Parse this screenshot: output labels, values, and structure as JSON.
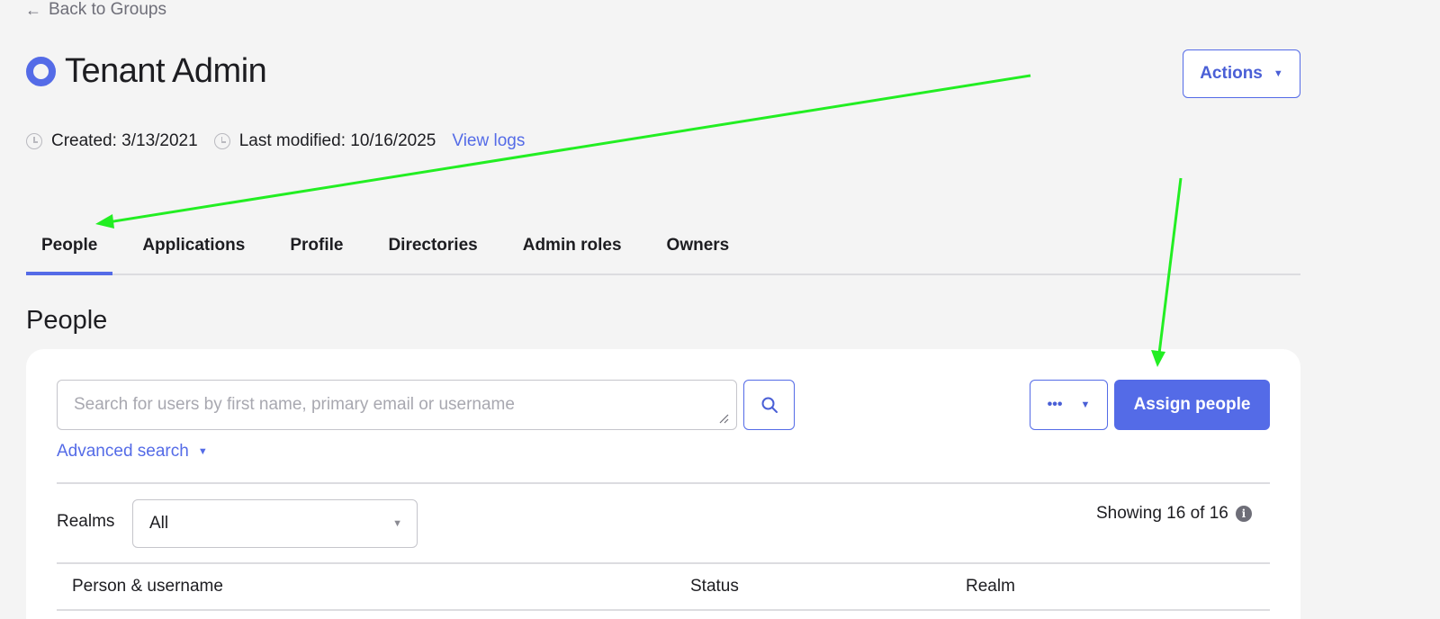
{
  "nav": {
    "back_label": "Back to Groups",
    "back_icon": "arrow-left-icon"
  },
  "header": {
    "title": "Tenant Admin",
    "actions_label": "Actions",
    "created": "Created: 3/13/2021",
    "last_modified": "Last modified: 10/16/2025",
    "view_logs": "View logs"
  },
  "tabs": [
    {
      "label": "People",
      "active": true
    },
    {
      "label": "Applications",
      "active": false
    },
    {
      "label": "Profile",
      "active": false
    },
    {
      "label": "Directories",
      "active": false
    },
    {
      "label": "Admin roles",
      "active": false
    },
    {
      "label": "Owners",
      "active": false
    }
  ],
  "section": {
    "title": "People"
  },
  "toolbar": {
    "search_placeholder": "Search for users by first name, primary email or username",
    "more_label": "•••",
    "assign_label": "Assign people",
    "advanced_search": "Advanced search"
  },
  "filters": {
    "realms_label": "Realms",
    "realms_value": "All",
    "showing": "Showing 16 of 16"
  },
  "table": {
    "columns": [
      "Person & username",
      "Status",
      "Realm"
    ]
  },
  "colors": {
    "accent": "#546be7",
    "background": "#f4f4f4",
    "annotation_arrow": "#22ee22"
  }
}
